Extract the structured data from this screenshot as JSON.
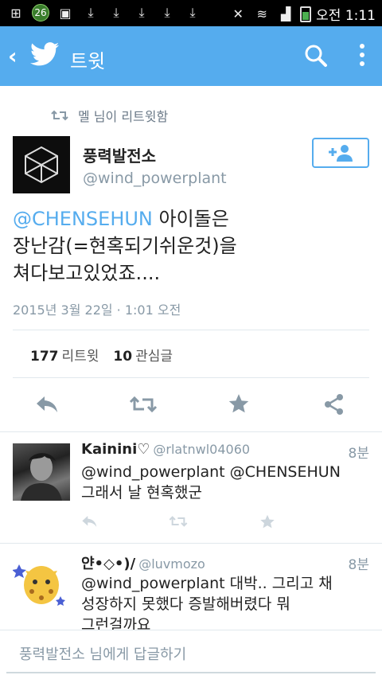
{
  "status_bar": {
    "notification_count": "26",
    "time": "오전 1:11"
  },
  "app_bar": {
    "title": "트윗"
  },
  "tweet": {
    "retweet_note": "멜 님이 리트윗함",
    "author_name": "풍력발전소",
    "author_handle": "@wind_powerplant",
    "text_mention": "@CHENSEHUN",
    "text_line1_rest": " 아이돌은",
    "text_line2": "장난감(=현혹되기쉬운것)을",
    "text_line3": "쳐다보고있었죠....",
    "timestamp": "2015년 3월 22일 · 1:01 오전",
    "retweet_count": "177",
    "retweet_label": "리트윗",
    "favorite_count": "10",
    "favorite_label": "관심글"
  },
  "replies": [
    {
      "name": "Kainini♡",
      "handle": "@rlatnwl04060",
      "time": "8분",
      "text_line1": "@wind_powerplant @CHENSEHUN",
      "text_line2": "그래서 날 현혹했군"
    },
    {
      "name": "얀•◇•)/",
      "handle": "@luvmozo",
      "time": "8분",
      "text_line1": "@wind_powerplant 대박.. 그리고 채",
      "text_line2": "성장하지 못했다 증발해버렸다 뭐",
      "text_line3": "그런걸까요"
    }
  ],
  "reply_bar": {
    "placeholder": "풍력발전소 님에게 답글하기"
  },
  "colors": {
    "accent": "#55acee",
    "muted_text": "#8899a6",
    "divider": "#e1e8ed"
  }
}
